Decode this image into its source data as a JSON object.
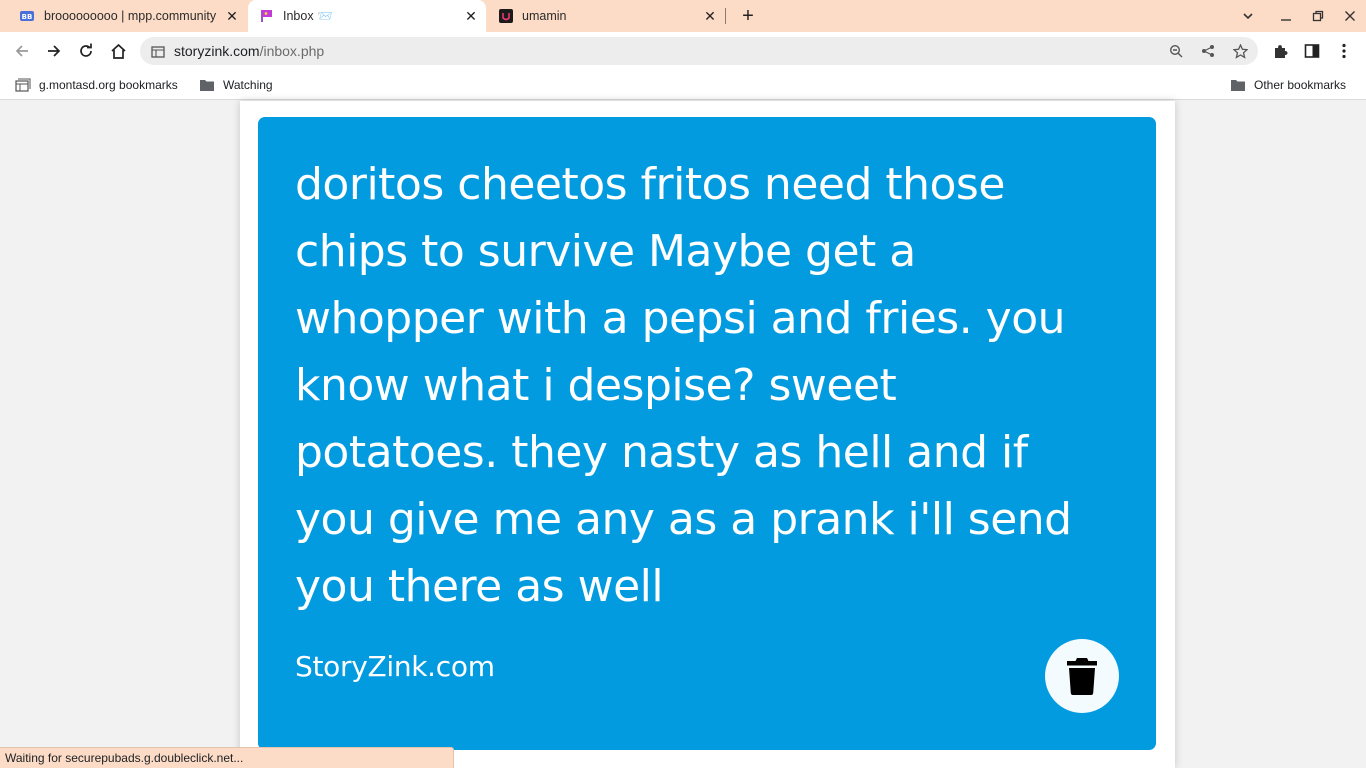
{
  "browser": {
    "tabs": [
      {
        "title": "brooooooooo | mpp.community",
        "icon": "mpp-favicon",
        "active": false
      },
      {
        "title": "Inbox 📨",
        "icon": "storyzink-favicon",
        "active": true
      },
      {
        "title": "umamin",
        "icon": "umamin-favicon",
        "active": false
      }
    ],
    "new_tab_label": "+",
    "address": {
      "domain": "storyzink.com",
      "path": "/inbox.php"
    },
    "bookmarks": {
      "left": [
        {
          "label": "g.montasd.org bookmarks",
          "icon": "bookmark-page-icon"
        },
        {
          "label": "Watching",
          "icon": "folder-icon"
        }
      ],
      "right": {
        "label": "Other bookmarks",
        "icon": "folder-icon"
      }
    },
    "status_text": "Waiting for securepubads.g.doubleclick.net..."
  },
  "page": {
    "message": "doritos cheetos fritos need those chips to survive Maybe get a whopper with a pepsi and fries. you know what i despise? sweet potatoes. they nasty as hell and if you give me any as a prank i'll send you there as well",
    "brand": "StoryZink.com",
    "delete_icon": "trash-icon"
  },
  "colors": {
    "tabstrip": "#fcdcc7",
    "card": "#039be0",
    "delete_button_bg": "#f3fbff"
  }
}
